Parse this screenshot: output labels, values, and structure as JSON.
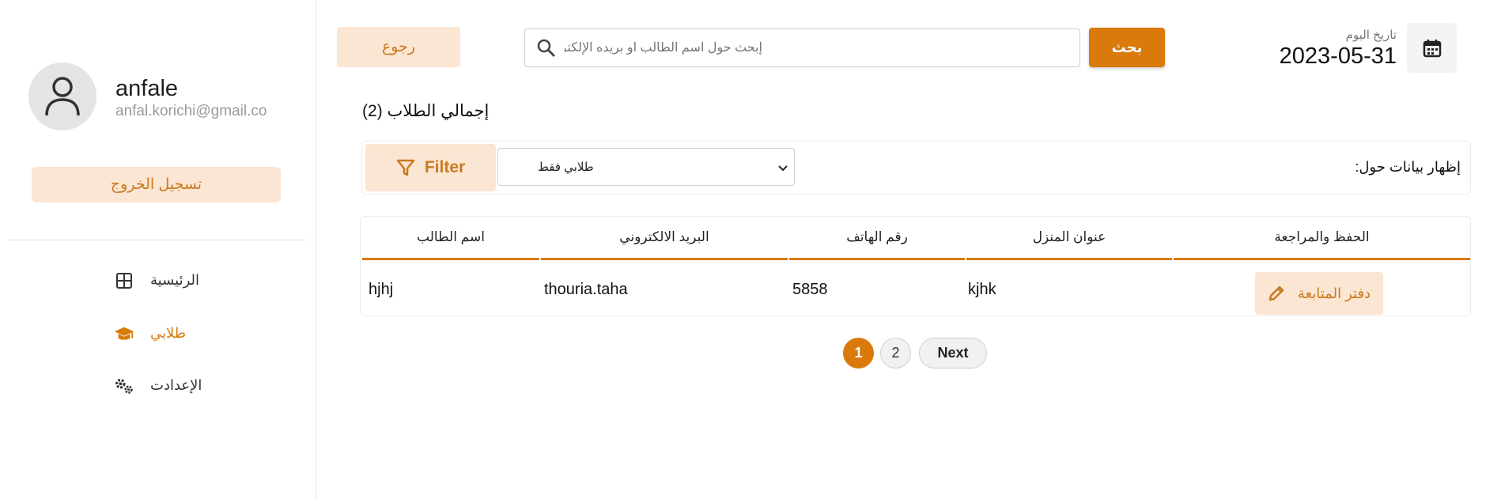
{
  "sidebar": {
    "user_name": "anfale",
    "user_email": "anfal.korichi@gmail.co",
    "logout_label": "تسجيل الخروج",
    "items": [
      {
        "label": "الرئيسية",
        "icon": "grid-icon"
      },
      {
        "label": "طلابي",
        "icon": "graduation-cap-icon",
        "active": true
      },
      {
        "label": "الإعدادت",
        "icon": "gears-icon"
      }
    ]
  },
  "header": {
    "back_label": "رجوع",
    "search_placeholder": "إبحث حول اسم الطالب او بريده الإلكتروني",
    "search_button": "بحث",
    "date_label": "تاريخ اليوم",
    "date_value": "2023-05-31"
  },
  "summary": {
    "total_label": "إجمالي الطلاب (2)"
  },
  "filter": {
    "button_label": "Filter",
    "selected_option": "طلابي فقط",
    "show_data_label": "إظهار بيانات حول:"
  },
  "table": {
    "headers": [
      "اسم الطالب",
      "البريد الالكتروني",
      "رقم الهاتف",
      "عنوان المنزل",
      "الحفظ والمراجعة"
    ],
    "rows": [
      {
        "name": "hjhj",
        "email": "thouria.taha",
        "phone": "5858",
        "address": "kjhk",
        "action": "دفتر المتابعة"
      }
    ]
  },
  "pagination": {
    "pages": [
      "1",
      "2"
    ],
    "current": "1",
    "next_label": "Next"
  },
  "colors": {
    "accent": "#d97a0b",
    "accent_light": "#fbe5d3"
  }
}
